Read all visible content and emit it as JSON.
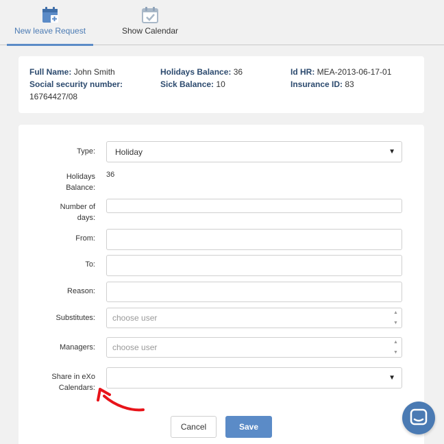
{
  "tabs": [
    {
      "label": "New leave Request",
      "icon": "calendar-add-icon",
      "active": true
    },
    {
      "label": "Show Calendar",
      "icon": "calendar-check-icon",
      "active": false
    }
  ],
  "employee": {
    "full_name_label": "Full Name:",
    "full_name": "John Smith",
    "ssn_label": "Social security number:",
    "ssn": "16764427/08",
    "holidays_balance_label": "Holidays Balance:",
    "holidays_balance": "36",
    "sick_balance_label": "Sick Balance:",
    "sick_balance": "10",
    "id_hr_label": "Id HR:",
    "id_hr": "MEA-2013-06-17-01",
    "insurance_label": "Insurance ID:",
    "insurance_id": "83"
  },
  "form": {
    "type_label": "Type:",
    "type_value": "Holiday",
    "holidays_balance_label_1": "Holidays",
    "holidays_balance_label_2": "Balance:",
    "holidays_balance_value": "36",
    "days_label_1": "Number of",
    "days_label_2": "days:",
    "days_value": "",
    "from_label": "From:",
    "from_value": "",
    "to_label": "To:",
    "to_value": "",
    "reason_label": "Reason:",
    "reason_value": "",
    "substitutes_label": "Substitutes:",
    "substitutes_placeholder": "choose user",
    "managers_label": "Managers:",
    "managers_placeholder": "choose user",
    "share_label_1": "Share in eXo",
    "share_label_2": "Calendars:",
    "share_value": "",
    "cancel_label": "Cancel",
    "save_label": "Save"
  },
  "colors": {
    "accent": "#5b8bc7",
    "annotation": "#e8141a"
  },
  "chat_icon": "chat-bubble-icon"
}
